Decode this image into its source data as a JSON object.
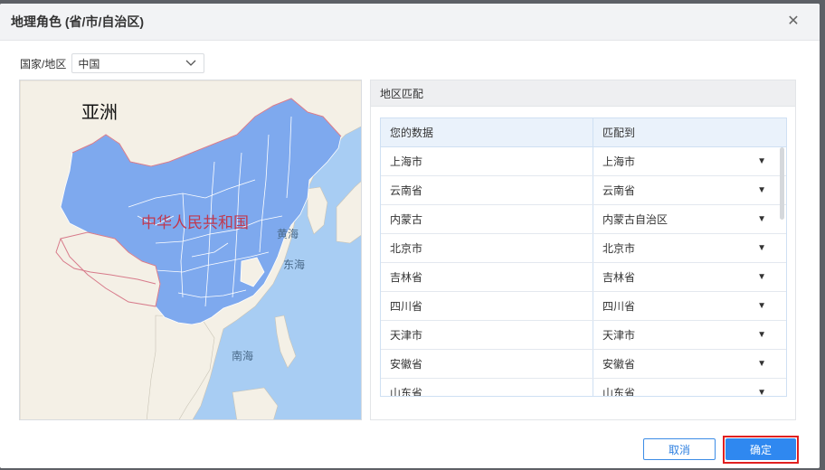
{
  "dialog": {
    "title": "地理角色 (省/市/自治区)",
    "close_icon": "close-icon"
  },
  "region": {
    "label": "国家/地区",
    "selected": "中国"
  },
  "map": {
    "continent_label": "亚洲",
    "country_label": "中华人民共和国",
    "sea_labels": [
      "黄海",
      "东海",
      "南海"
    ],
    "colors": {
      "water": "#a8cdf3",
      "land": "#f4f0e6",
      "highlight": "#7ea9ee",
      "border": "#d77a8a"
    }
  },
  "match": {
    "title": "地区匹配",
    "columns": [
      "您的数据",
      "匹配到"
    ],
    "rows": [
      {
        "data": "上海市",
        "match": "上海市"
      },
      {
        "data": "云南省",
        "match": "云南省"
      },
      {
        "data": "内蒙古",
        "match": "内蒙古自治区"
      },
      {
        "data": "北京市",
        "match": "北京市"
      },
      {
        "data": "吉林省",
        "match": "吉林省"
      },
      {
        "data": "四川省",
        "match": "四川省"
      },
      {
        "data": "天津市",
        "match": "天津市"
      },
      {
        "data": "安徽省",
        "match": "安徽省"
      },
      {
        "data": "山东省",
        "match": "山东省"
      }
    ]
  },
  "buttons": {
    "cancel": "取消",
    "ok": "确定"
  },
  "colors": {
    "accent": "#2f88f0",
    "highlight_frame": "#e02020"
  }
}
